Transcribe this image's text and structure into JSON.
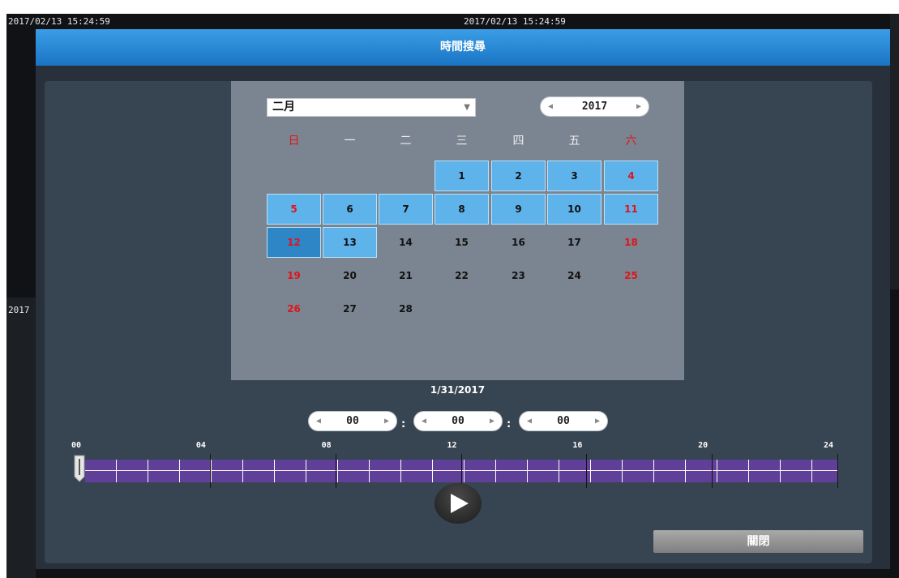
{
  "camera": {
    "timestamp_left": "2017/02/13 15:24:59",
    "timestamp_center": "2017/02/13 15:24:59",
    "timestamp_lower": "2017"
  },
  "dialog": {
    "title": "時間搜尋",
    "close_label": "關閉"
  },
  "calendar": {
    "month": "二月",
    "year": "2017",
    "weekdays": [
      "日",
      "一",
      "二",
      "三",
      "四",
      "五",
      "六"
    ],
    "days": [
      "1",
      "2",
      "3",
      "4",
      "5",
      "6",
      "7",
      "8",
      "9",
      "10",
      "11",
      "12",
      "13",
      "14",
      "15",
      "16",
      "17",
      "18",
      "19",
      "20",
      "21",
      "22",
      "23",
      "24",
      "25",
      "26",
      "27",
      "28"
    ],
    "recorded_days": [
      1,
      2,
      3,
      4,
      5,
      6,
      7,
      8,
      9,
      10,
      11,
      12,
      13
    ],
    "selected_day": 12,
    "colors": {
      "recorded": "#5fb3eb",
      "selected": "#2e86c6",
      "weekend": "#e0141a"
    }
  },
  "selected_date": "1/31/2017",
  "time": {
    "hour": "00",
    "minute": "00",
    "second": "00"
  },
  "timeline": {
    "hour_labels": [
      "00",
      "04",
      "08",
      "12",
      "16",
      "20",
      "24"
    ],
    "position_hours": 0,
    "bar_color": "#5f3f98"
  },
  "icons": {
    "prev": "arrow-left-icon",
    "next": "arrow-right-icon",
    "dropdown": "chevron-down-icon",
    "play": "play-icon"
  }
}
